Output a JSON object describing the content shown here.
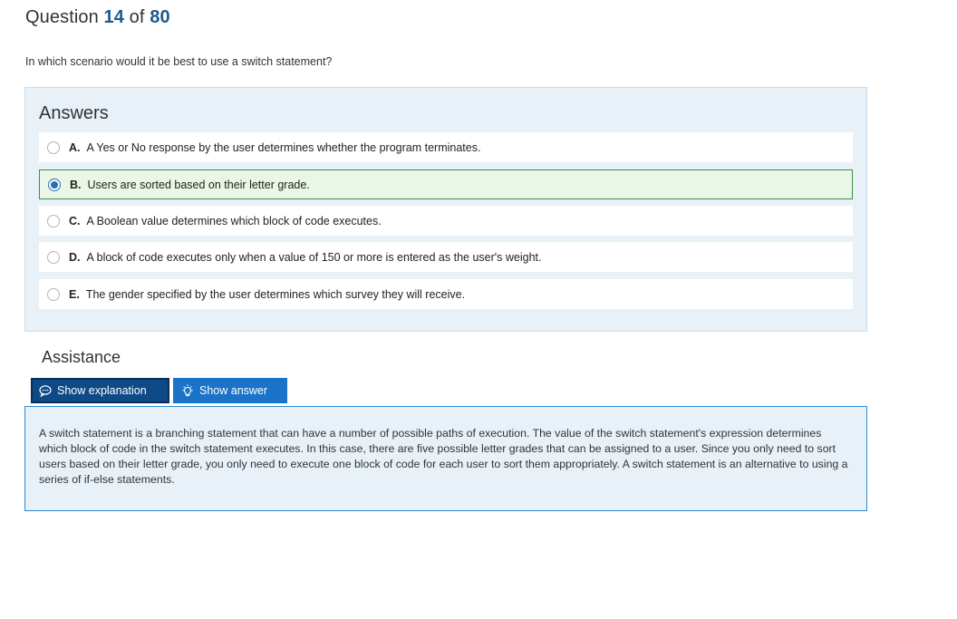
{
  "question": {
    "label": "Question",
    "number": "14",
    "of_label": "of",
    "total": "80",
    "text": "In which scenario would it be best to use a switch statement?"
  },
  "answers": {
    "title": "Answers",
    "selected": "B",
    "items": [
      {
        "letter": "A.",
        "text": "A Yes or No response by the user determines whether the program terminates."
      },
      {
        "letter": "B.",
        "text": "Users are sorted based on their letter grade."
      },
      {
        "letter": "C.",
        "text": "A Boolean value determines which block of code executes."
      },
      {
        "letter": "D.",
        "text": "A block of code executes only when a value of 150 or more is entered as the user's weight."
      },
      {
        "letter": "E.",
        "text": "The gender specified by the user determines which survey they will receive."
      }
    ]
  },
  "assistance": {
    "title": "Assistance",
    "show_explanation_label": "Show explanation",
    "show_answer_label": "Show answer",
    "explanation_icon": "speech-bubble-icon",
    "answer_icon": "lightbulb-icon",
    "explanation_text": "A switch statement is a branching statement that can have a number of possible paths of execution. The value of the switch statement's expression determines which block of code in the switch statement executes. In this case, there are five possible letter grades that can be assigned to a user. Since you only need to sort users based on their letter grade, you only need to execute one block of code for each user to sort them appropriately. A switch statement is an alternative to using a series of if-else statements."
  },
  "colors": {
    "accent": "#1a73c9",
    "selected_border": "#3e8e41",
    "panel_bg": "#e8f1f8"
  }
}
